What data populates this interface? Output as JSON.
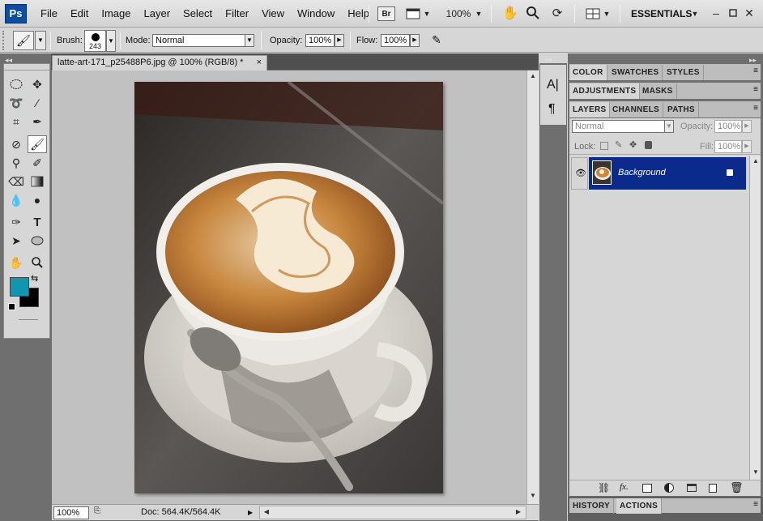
{
  "app": {
    "logo": "Ps"
  },
  "menu": {
    "items": [
      "File",
      "Edit",
      "Image",
      "Layer",
      "Select",
      "Filter",
      "View",
      "Window",
      "Help"
    ]
  },
  "toolbar": {
    "bridge_label": "Br",
    "zoom": "100%",
    "workspace": "ESSENTIALS"
  },
  "options": {
    "brush_label": "Brush:",
    "brush_size": "243",
    "mode_label": "Mode:",
    "mode_value": "Normal",
    "opacity_label": "Opacity:",
    "opacity_value": "100%",
    "flow_label": "Flow:",
    "flow_value": "100%"
  },
  "tools": {
    "foreground_color": "#1296b0",
    "background_color": "#000000"
  },
  "document": {
    "tab_title": "latte-art-171_p25488P6.jpg @ 100% (RGB/8) *",
    "close": "×",
    "zoom": "100%",
    "doc_info": "Doc: 564.4K/564.4K"
  },
  "panels": {
    "group1": [
      "COLOR",
      "SWATCHES",
      "STYLES"
    ],
    "group2": [
      "ADJUSTMENTS",
      "MASKS"
    ],
    "group3": [
      "LAYERS",
      "CHANNELS",
      "PATHS"
    ],
    "blend_mode": "Normal",
    "opacity_label": "Opacity:",
    "opacity_value": "100%",
    "lock_label": "Lock:",
    "fill_label": "Fill:",
    "fill_value": "100%",
    "layer_name": "Background",
    "bottom_tabs": [
      "HISTORY",
      "ACTIONS"
    ]
  },
  "colors": {
    "selection": "#0a2a8c",
    "accent_fg": "#1296b0"
  }
}
